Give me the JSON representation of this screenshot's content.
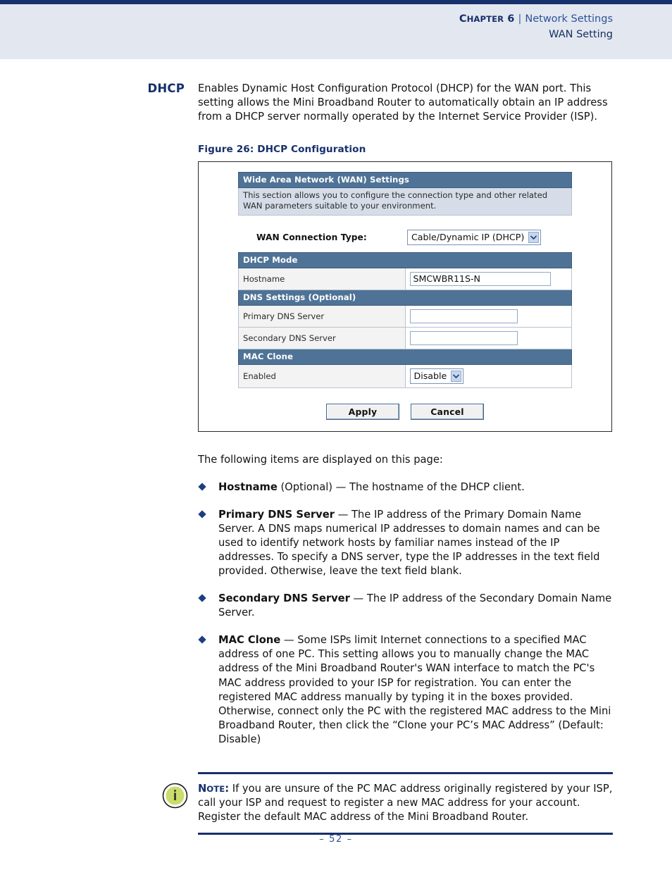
{
  "header": {
    "chapter_label_first": "C",
    "chapter_label_rest": "HAPTER",
    "chapter_number": "6",
    "separator": "|",
    "topic": "Network Settings",
    "subtitle": "WAN Setting"
  },
  "section": {
    "margin_heading": "DHCP",
    "paragraph": "Enables Dynamic Host Configuration Protocol (DHCP) for the WAN port. This setting allows the Mini Broadband Router to automatically obtain an IP address from a DHCP server normally operated by the Internet Service Provider (ISP)."
  },
  "figure": {
    "caption": "Figure 26:  DHCP Configuration",
    "ui": {
      "title_bar": "Wide Area Network (WAN) Settings",
      "description": "This section allows you to configure the connection type and other related WAN parameters suitable to your environment.",
      "connection_type_label": "WAN Connection Type:",
      "connection_type_value": "Cable/Dynamic IP (DHCP)",
      "sections": [
        {
          "header": "DHCP Mode",
          "rows": [
            {
              "label": "Hostname",
              "value": "SMCWBR11S-N",
              "control": "text"
            }
          ]
        },
        {
          "header": "DNS Settings (Optional)",
          "rows": [
            {
              "label": "Primary DNS Server",
              "value": "",
              "control": "text"
            },
            {
              "label": "Secondary DNS Server",
              "value": "",
              "control": "text"
            }
          ]
        },
        {
          "header": "MAC Clone",
          "rows": [
            {
              "label": "Enabled",
              "value": "Disable",
              "control": "select"
            }
          ]
        }
      ],
      "buttons": {
        "apply": "Apply",
        "cancel": "Cancel"
      }
    }
  },
  "body": {
    "intro": "The following items are displayed on this page:",
    "bullets": [
      {
        "term": "Hostname",
        "rest": " (Optional) — The hostname of the DHCP client."
      },
      {
        "term": "Primary DNS Server",
        "rest": " — The IP address of the Primary Domain Name Server. A DNS maps numerical IP addresses to domain names and can be used to identify network hosts by familiar names instead of the IP addresses. To specify a DNS server, type the IP addresses in the text field provided. Otherwise, leave the text field blank."
      },
      {
        "term": "Secondary DNS Server",
        "rest": " — The IP address of the Secondary Domain Name Server."
      },
      {
        "term": "MAC Clone",
        "rest": " — Some ISPs limit Internet connections to a specified MAC address of one PC. This setting allows you to manually change the MAC address of the Mini Broadband Router's WAN interface to match the PC's MAC address provided to your ISP for registration. You can enter the registered MAC address manually by typing it in the boxes provided. Otherwise, connect only the PC with the registered MAC address to the Mini Broadband Router, then click the “Clone your PC’s MAC Address” (Default: Disable)"
      }
    ]
  },
  "note": {
    "label_first": "N",
    "label_rest": "OTE",
    "label_colon": ":",
    "text": " If you are unsure of the PC MAC address originally registered by your ISP, call your ISP and request to register a new MAC address for your account. Register the default MAC address of the Mini Broadband Router.",
    "icon_glyph": "i",
    "icon_color": "#c9dd6b"
  },
  "footer": {
    "page_number": "–  52  –"
  },
  "colors": {
    "navy": "#16306b",
    "link_blue": "#2b5397",
    "header_band": "#e3e7f0",
    "ui_section_bar": "#4f7396",
    "ui_description_bg": "#d6dde8"
  }
}
